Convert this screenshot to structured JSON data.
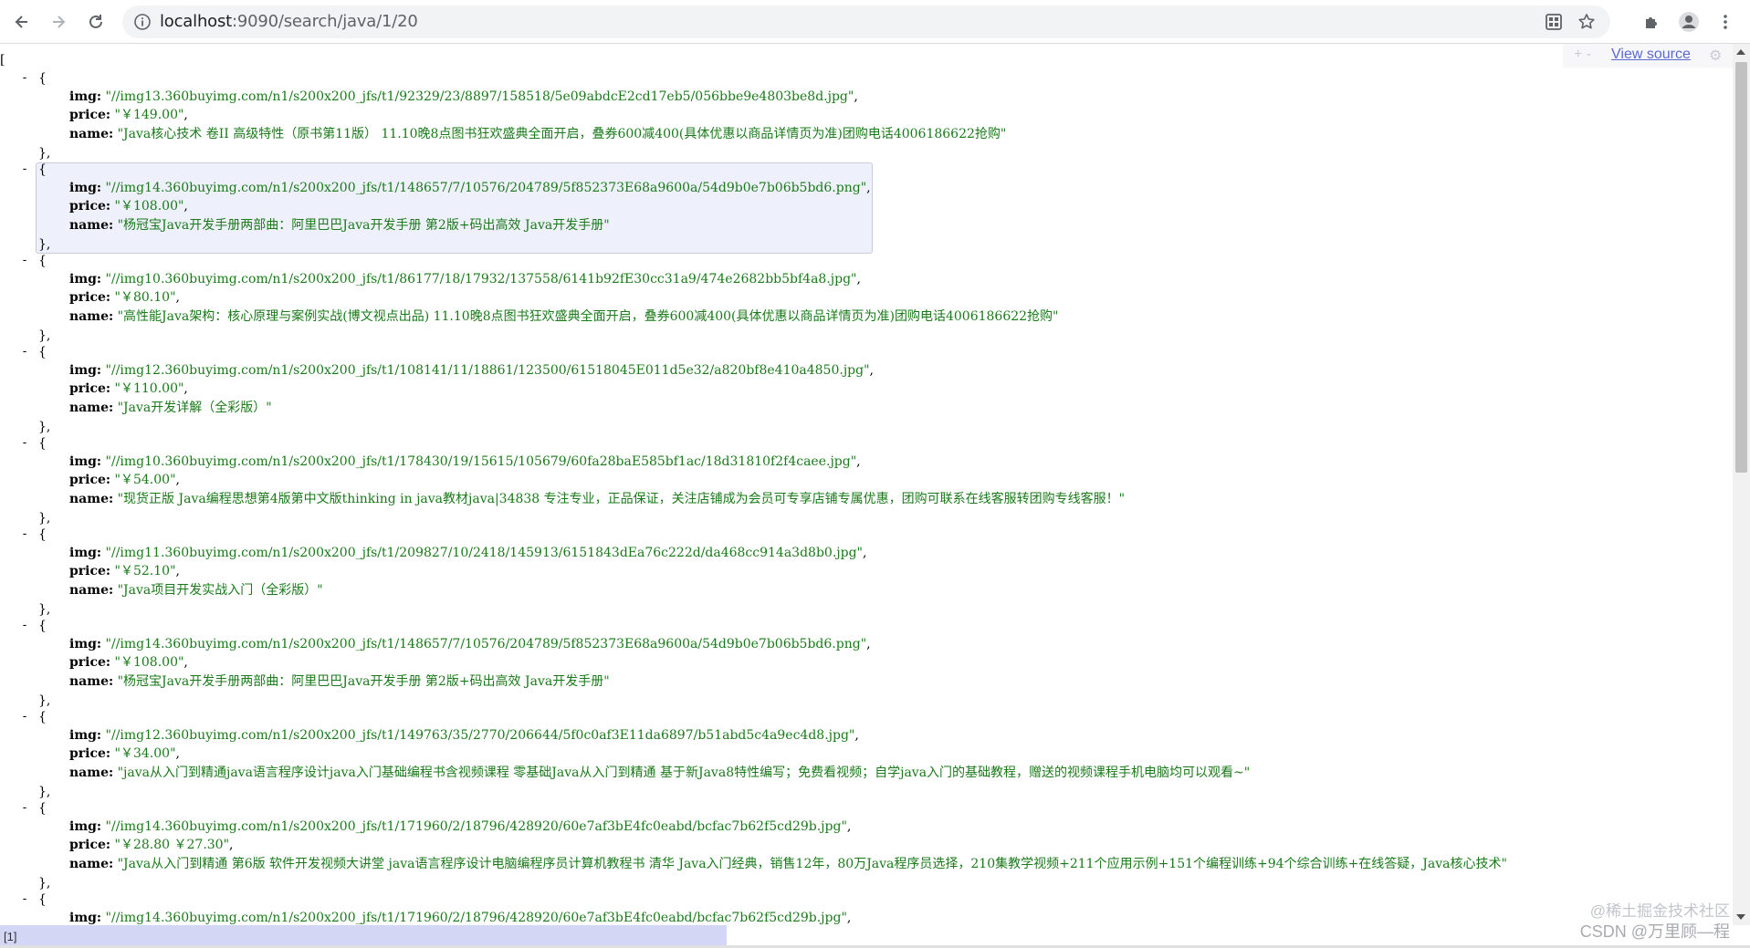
{
  "browser": {
    "url_host": "localhost",
    "url_rest": ":9090/search/java/1/20",
    "icons": {
      "back": "arrow-left-icon",
      "forward": "arrow-right-icon",
      "reload": "reload-icon",
      "info": "info-icon",
      "qr": "qr-code-icon",
      "bookmark": "star-icon",
      "extensions": "puzzle-icon",
      "profile": "avatar-icon",
      "menu": "more-vertical-icon"
    }
  },
  "viewer": {
    "open_bracket": "[",
    "view_source_plus": "+ -",
    "view_source_label": "View source",
    "items": [
      {
        "img": "\"//img13.360buyimg.com/n1/s200x200_jfs/t1/92329/23/8897/158518/5e09abdcE2cd17eb5/056bbe9e4803be8d.jpg\"",
        "price": "\"￥149.00\"",
        "name": "\"Java核心技术 卷II 高级特性（原书第11版） 11.10晚8点图书狂欢盛典全面开启，叠券600减400(具体优惠以商品详情页为准)团购电话4006186622抢购\""
      },
      {
        "img": "\"//img14.360buyimg.com/n1/s200x200_jfs/t1/148657/7/10576/204789/5f852373E68a9600a/54d9b0e7b06b5bd6.png\"",
        "price": "\"￥108.00\"",
        "name": "\"杨冠宝Java开发手册两部曲：阿里巴巴Java开发手册 第2版+码出高效 Java开发手册\""
      },
      {
        "img": "\"//img10.360buyimg.com/n1/s200x200_jfs/t1/86177/18/17932/137558/6141b92fE30cc31a9/474e2682bb5bf4a8.jpg\"",
        "price": "\"￥80.10\"",
        "name": "\"高性能Java架构：核心原理与案例实战(博文视点出品) 11.10晚8点图书狂欢盛典全面开启，叠券600减400(具体优惠以商品详情页为准)团购电话4006186622抢购\""
      },
      {
        "img": "\"//img12.360buyimg.com/n1/s200x200_jfs/t1/108141/11/18861/123500/61518045E011d5e32/a820bf8e410a4850.jpg\"",
        "price": "\"￥110.00\"",
        "name": "\"Java开发详解（全彩版）\""
      },
      {
        "img": "\"//img10.360buyimg.com/n1/s200x200_jfs/t1/178430/19/15615/105679/60fa28baE585bf1ac/18d31810f2f4caee.jpg\"",
        "price": "\"￥54.00\"",
        "name": "\"现货正版 Java编程思想第4版第中文版thinking in java教材java|34838 专注专业，正品保证，关注店铺成为会员可专享店铺专属优惠，团购可联系在线客服转团购专线客服！\""
      },
      {
        "img": "\"//img11.360buyimg.com/n1/s200x200_jfs/t1/209827/10/2418/145913/6151843dEa76c222d/da468cc914a3d8b0.jpg\"",
        "price": "\"￥52.10\"",
        "name": "\"Java项目开发实战入门（全彩版）\""
      },
      {
        "img": "\"//img14.360buyimg.com/n1/s200x200_jfs/t1/148657/7/10576/204789/5f852373E68a9600a/54d9b0e7b06b5bd6.png\"",
        "price": "\"￥108.00\"",
        "name": "\"杨冠宝Java开发手册两部曲：阿里巴巴Java开发手册 第2版+码出高效 Java开发手册\""
      },
      {
        "img": "\"//img12.360buyimg.com/n1/s200x200_jfs/t1/149763/35/2770/206644/5f0c0af3E11da6897/b51abd5c4a9ec4d8.jpg\"",
        "price": "\"￥34.00\"",
        "name": "\"java从入门到精通java语言程序设计java入门基础编程书含视频课程 零基础Java从入门到精通 基于新Java8特性编写；免费看视频；自学java入门的基础教程，赠送的视频课程手机电脑均可以观看~\""
      },
      {
        "img": "\"//img14.360buyimg.com/n1/s200x200_jfs/t1/171960/2/18796/428920/60e7af3bE4fc0eabd/bcfac7b62f5cd29b.jpg\"",
        "price": "\"￥28.80 ￥27.30\"",
        "name": "\"Java从入门到精通 第6版 软件开发视频大讲堂 java语言程序设计电脑编程序员计算机教程书 清华 Java入门经典，销售12年，80万Java程序员选择，210集教学视频+211个应用示例+151个编程训练+94个综合训练+在线答疑，Java核心技术\""
      },
      {
        "img": "\"//img14.360buyimg.com/n1/s200x200_jfs/t1/171960/2/18796/428920/60e7af3bE4fc0eabd/bcfac7b62f5cd29b.jpg\"",
        "price": "",
        "name": ""
      }
    ],
    "key_img": "img:",
    "key_price": "price:",
    "key_name": "name:",
    "collapser": "-",
    "open_brace": "{",
    "close_brace": "},",
    "comma": ","
  },
  "status": {
    "path": "[1]"
  },
  "watermark": {
    "line1": "@稀土掘金技术社区",
    "line2": "CSDN @万里顾—程"
  }
}
